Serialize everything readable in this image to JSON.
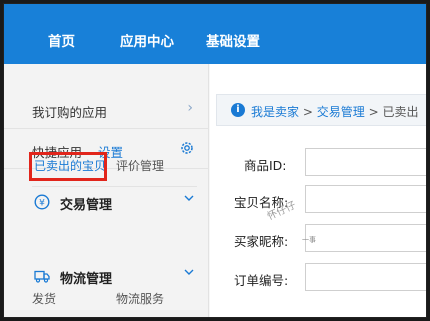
{
  "topnav": {
    "items": [
      "首页",
      "应用中心",
      "基础设置"
    ]
  },
  "sidebar": {
    "subscribed_label": "我订购的应用",
    "quick_label": "快捷应用",
    "quick_setting": "设置",
    "groups": [
      {
        "title": "交易管理",
        "subs": [
          "已卖出的宝贝",
          "评价管理"
        ]
      },
      {
        "title": "物流管理",
        "subs": [
          "发货",
          "物流服务"
        ]
      }
    ]
  },
  "breadcrumb": {
    "part1": "我是卖家",
    "sep": ">",
    "part2": "交易管理",
    "part3": "已卖出"
  },
  "form": {
    "labels": [
      "商品ID:",
      "宝贝名称:",
      "买家昵称:",
      "订单编号:"
    ]
  },
  "watermark": {
    "text": "怀仔仔",
    "sub": "一事"
  },
  "colors": {
    "nav_blue": "#1880d8",
    "link_blue": "#1a7ad4",
    "highlight_red": "#e1251b"
  }
}
